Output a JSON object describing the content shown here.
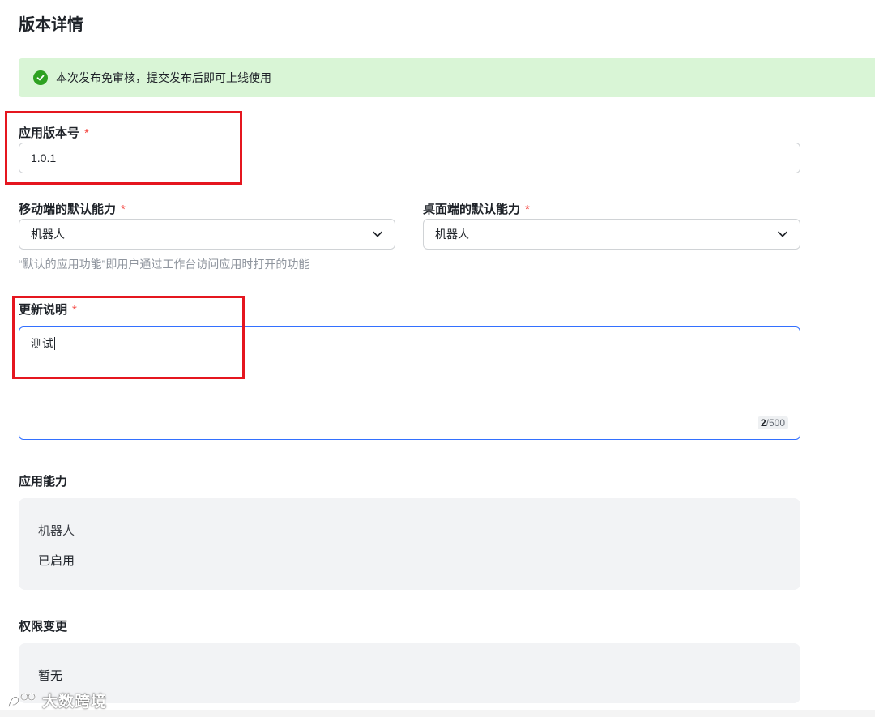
{
  "page": {
    "title": "版本详情"
  },
  "notice": {
    "text": "本次发布免审核，提交发布后即可上线使用"
  },
  "version": {
    "label": "应用版本号",
    "required_mark": "*",
    "value": "1.0.1"
  },
  "mobile_default": {
    "label": "移动端的默认能力",
    "required_mark": "*",
    "value": "机器人"
  },
  "desktop_default": {
    "label": "桌面端的默认能力",
    "required_mark": "*",
    "value": "机器人"
  },
  "helper": {
    "text": "“默认的应用功能”即用户通过工作台访问应用时打开的功能"
  },
  "update_notes": {
    "label": "更新说明",
    "required_mark": "*",
    "value": "测试",
    "count_current": "2",
    "count_max": "/500"
  },
  "capabilities": {
    "title": "应用能力",
    "items": [
      {
        "name": "机器人",
        "status": "已启用"
      }
    ]
  },
  "permissions": {
    "title": "权限变更",
    "value": "暂无"
  },
  "watermark": {
    "text": "大数跨境"
  },
  "colors": {
    "accent": "#3370ff",
    "success": "#2ea121",
    "notice_bg": "#d9f5d6",
    "required": "#f54a45",
    "highlight": "#e5161f",
    "panel_bg": "#f2f3f5"
  }
}
